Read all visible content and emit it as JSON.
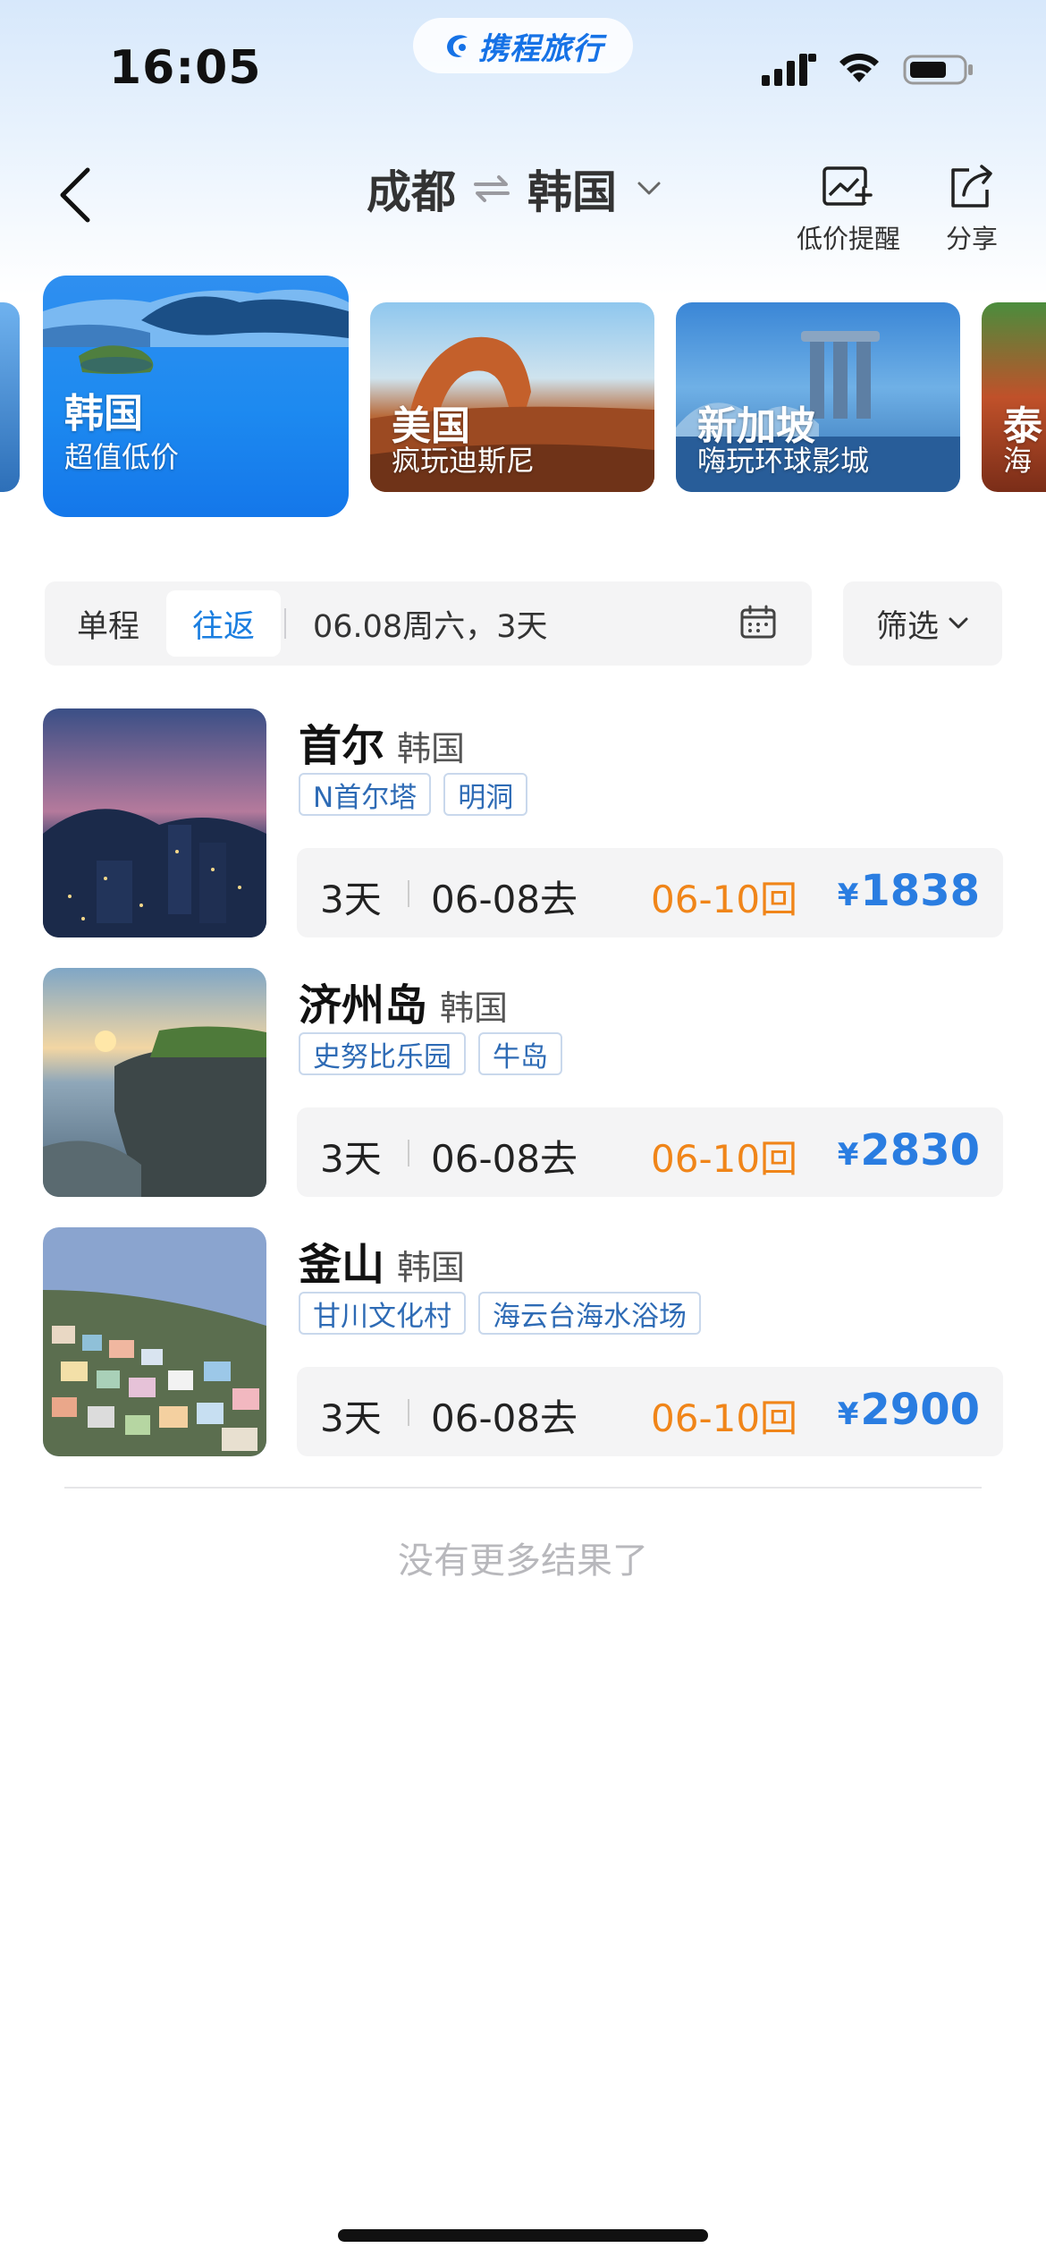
{
  "status_bar": {
    "time": "16:05",
    "brand": "携程旅行"
  },
  "nav": {
    "origin": "成都",
    "destination": "韩国",
    "actions": [
      {
        "label": "低价提醒",
        "icon": "price-alert-icon"
      },
      {
        "label": "分享",
        "icon": "share-icon"
      }
    ]
  },
  "destinations": [
    {
      "name": "韩国",
      "subtitle": "超值低价",
      "selected": true
    },
    {
      "name": "美国",
      "subtitle": "疯玩迪斯尼",
      "selected": false
    },
    {
      "name": "新加坡",
      "subtitle": "嗨玩环球影城",
      "selected": false
    },
    {
      "name": "泰",
      "subtitle": "海",
      "selected": false
    }
  ],
  "filters": {
    "trip_types": [
      "单程",
      "往返"
    ],
    "selected_trip_type": "往返",
    "date": "06.08周六，3天",
    "filter_label": "筛选"
  },
  "results": [
    {
      "city": "首尔",
      "country": "韩国",
      "tags": [
        "N首尔塔",
        "明洞"
      ],
      "days": "3天",
      "depart": "06-08去",
      "return": "06-10回",
      "currency": "¥",
      "price": "1838"
    },
    {
      "city": "济州岛",
      "country": "韩国",
      "tags": [
        "史努比乐园",
        "牛岛"
      ],
      "days": "3天",
      "depart": "06-08去",
      "return": "06-10回",
      "currency": "¥",
      "price": "2830"
    },
    {
      "city": "釜山",
      "country": "韩国",
      "tags": [
        "甘川文化村",
        "海云台海水浴场"
      ],
      "days": "3天",
      "depart": "06-08去",
      "return": "06-10回",
      "currency": "¥",
      "price": "2900"
    }
  ],
  "footer": {
    "no_more": "没有更多结果了"
  },
  "colors": {
    "accent": "#1a7ee0",
    "price": "#2a7de1",
    "return_date": "#f08519"
  }
}
